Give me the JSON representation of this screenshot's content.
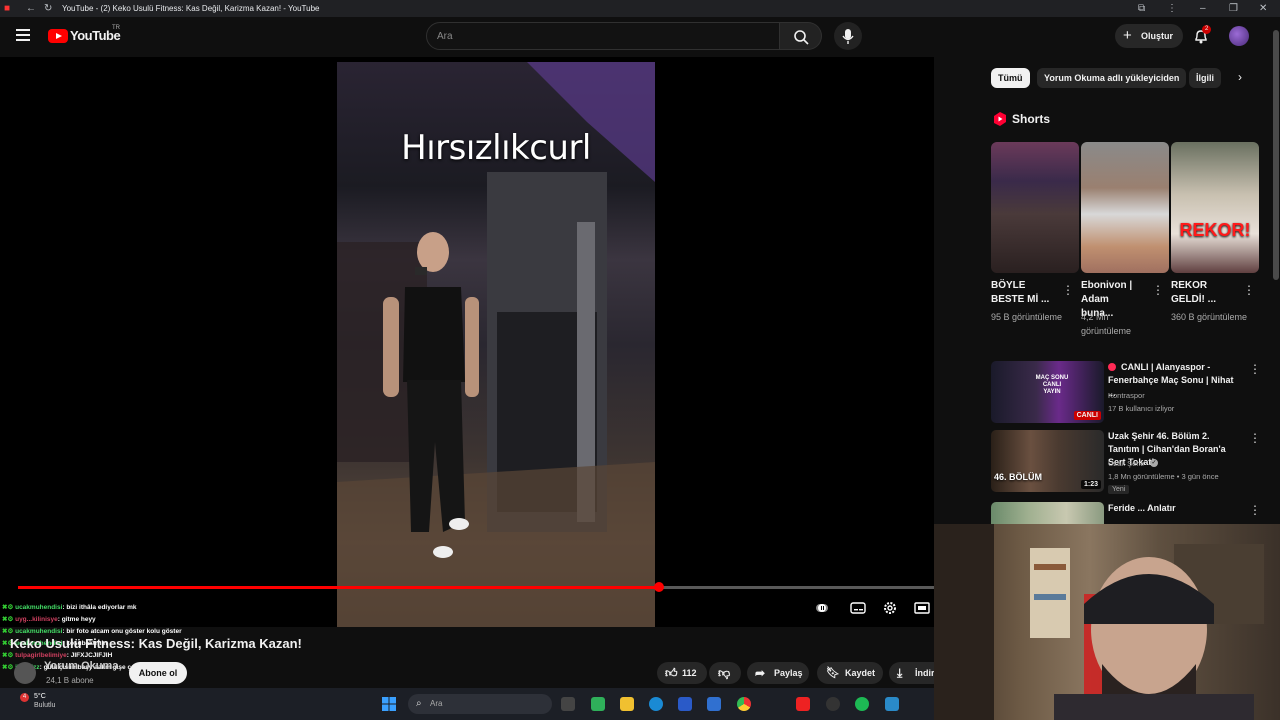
{
  "browser": {
    "tab_title": "YouTube - (2) Keko Usulü Fitness: Kas Değil, Karizma Kazan! - YouTube"
  },
  "header": {
    "logo_text": "YouTube",
    "region": "TR",
    "search_placeholder": "Ara",
    "create_label": "Oluştur",
    "notification_count": "2"
  },
  "chips": [
    "Tümü",
    "Yorum Okuma adlı yükleyiciden",
    "İlgili"
  ],
  "shorts": {
    "section_title": "Shorts",
    "items": [
      {
        "title": "BÖYLE BESTE Mİ ...",
        "views": "95 B görüntüleme"
      },
      {
        "title": "Ebonivon | Adam buna...",
        "views": "4,2 Mn görüntüleme"
      },
      {
        "title": "REKOR GELDİ! ...",
        "views": "360 B görüntüleme",
        "thumb_text": "REKOR!"
      }
    ]
  },
  "recommendations": [
    {
      "title": "CANLI | Alanyaspor - Fenerbahçe Maç Sonu | Nihat ...",
      "channel": "Kontraspor",
      "meta": "17 B kullanıcı izliyor",
      "badge": "CANLI",
      "thumb_text": "MAÇ SONU CANLI YAYIN"
    },
    {
      "title": "Uzak Şehir 46. Bölüm 2. Tanıtım | Cihan'dan Boran'a Sert Tokat!",
      "channel": "Uzak Şehir",
      "meta": "1,8 Mn görüntüleme • 3 gün önce",
      "tag": "Yeni",
      "duration": "1:23",
      "thumb_text": "46. BÖLÜM"
    },
    {
      "title": "Feride ... Anlatır",
      "channel": "",
      "meta": ""
    }
  ],
  "video": {
    "caption": "Hırsızlıkcurl",
    "title": "Keko Usulü Fitness: Kas Değil, Karizma Kazan!",
    "progress": 0.7,
    "channel": "Yorum Okuma",
    "subscribers": "24,1 B abone",
    "subscribe_label": "Abone ol",
    "likes": "112",
    "share_label": "Paylaş",
    "save_label": "Kaydet",
    "download_label": "İndir"
  },
  "chat": [
    {
      "user": "ucakmuhendisi",
      "msg": "bizi ithâla ediyorlar mk",
      "color": "g"
    },
    {
      "user": "uyg...kilinisye",
      "msg": "gitme heyy",
      "color": "r"
    },
    {
      "user": "ucakmuhendisi",
      "msg": "bir foto atcam onu göster kolu göster",
      "color": "g"
    },
    {
      "user": "ucakmuhendisi",
      "msg": "kosubaktrnin",
      "color": "g"
    },
    {
      "user": "tulpagirlbelimiye",
      "msg": "JIFXJCJIFJIH",
      "color": "r"
    },
    {
      "user": "ilaslsizz",
      "msg": "gülülçisiimbaşy aakm gişe çeye",
      "color": "g"
    }
  ],
  "taskbar": {
    "weather_temp": "5°C",
    "weather_desc": "Bulutlu",
    "weather_badge": "4",
    "search_placeholder": "Ara"
  },
  "colors": {
    "accent_red": "#ff0000",
    "background": "#0f0f0f",
    "chip_bg": "#272727"
  }
}
